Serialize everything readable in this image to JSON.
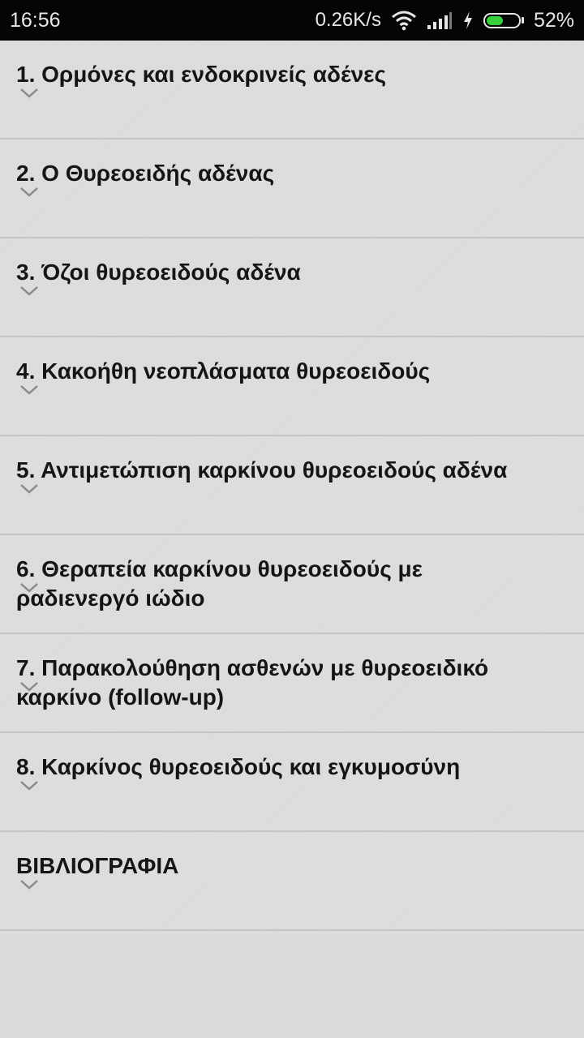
{
  "status_bar": {
    "time": "16:56",
    "network_speed": "0.26K/s",
    "battery_percent_text": "52%",
    "battery_level": 0.52,
    "icons": [
      "wifi-icon",
      "signal-icon",
      "charging-icon",
      "battery-icon"
    ],
    "colors": {
      "background": "#050505",
      "battery_fill": "#36d13b"
    }
  },
  "chapters": [
    {
      "label": "1. Ορμόνες και ενδοκρινείς αδένες"
    },
    {
      "label": "2. Ο Θυρεοειδής αδένας"
    },
    {
      "label": "3. Όζοι θυρεοειδούς αδένα"
    },
    {
      "label": "4. Κακοήθη νεοπλάσματα θυρεοειδούς"
    },
    {
      "label": "5. Αντιμετώπιση καρκίνου θυρεοειδούς αδένα"
    },
    {
      "label": "6. Θεραπεία καρκίνου θυρεοειδούς με ραδιενεργό ιώδιο"
    },
    {
      "label": "7. Παρακολούθηση ασθενών με θυρεοειδικό καρκίνο (follow-up)"
    },
    {
      "label": "8. Καρκίνος θυρεοειδούς και εγκυμοσύνη"
    },
    {
      "label": "ΒΙΒΛΙΟΓΡΑΦΙΑ"
    }
  ],
  "list_icon": "chevron-down-icon",
  "colors": {
    "page_background": "#dcdddb",
    "divider": "#c4c5c3",
    "text": "#151515"
  }
}
